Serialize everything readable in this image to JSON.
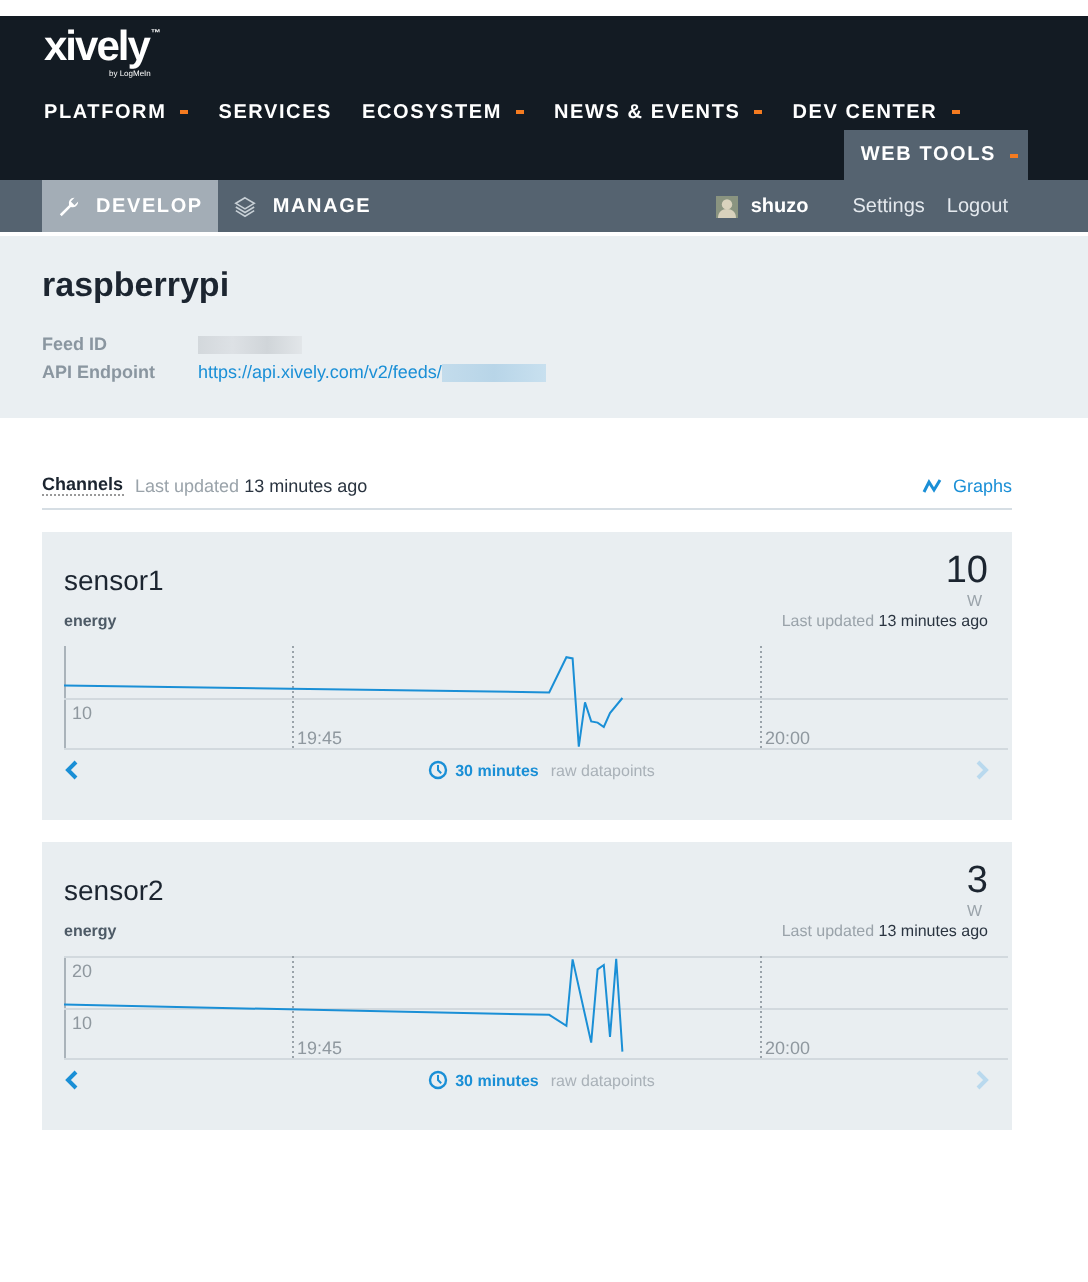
{
  "header": {
    "logo": {
      "name": "xively",
      "mark": "™",
      "tagline": "by LogMeIn"
    },
    "nav": [
      {
        "label": "PLATFORM",
        "has_menu": true
      },
      {
        "label": "SERVICES",
        "has_menu": false
      },
      {
        "label": "ECOSYSTEM",
        "has_menu": true
      },
      {
        "label": "NEWS & EVENTS",
        "has_menu": true
      },
      {
        "label": "DEV CENTER",
        "has_menu": true
      }
    ],
    "tools_tab": {
      "label": "WEB TOOLS",
      "has_menu": true,
      "selected": true
    }
  },
  "subnav": {
    "tabs": [
      {
        "label": "DEVELOP",
        "kind": "wrench",
        "selected": true
      },
      {
        "label": "MANAGE",
        "kind": "layers",
        "selected": false
      }
    ],
    "user": "shuzo",
    "links": [
      "Settings",
      "Logout"
    ]
  },
  "feed": {
    "title": "raspberrypi",
    "fields": [
      {
        "label": "Feed ID",
        "value_redacted": true
      },
      {
        "label": "API Endpoint",
        "value": "https://api.xively.com/v2/feeds/",
        "value_redacted": true
      }
    ]
  },
  "channels_bar": {
    "title": "Channels",
    "updated": "Last updated **13 minutes ago**",
    "graphs_link": "Graphs"
  },
  "channels": [
    {
      "name": "sensor1",
      "value": "10",
      "unit": "W",
      "tag": "energy",
      "updated": "Last updated **13 minutes ago**",
      "range": "30 minutes",
      "mode": "raw datapoints",
      "prev_disabled": false,
      "next_disabled": true,
      "graph": {
        "y_labels": [
          "10"
        ],
        "x_labels": [
          "19:45",
          "20:00"
        ]
      }
    },
    {
      "name": "sensor2",
      "value": "3",
      "unit": "W",
      "tag": "energy",
      "updated": "Last updated **13 minutes ago**",
      "range": "30 minutes",
      "mode": "raw datapoints",
      "prev_disabled": false,
      "next_disabled": true,
      "graph": {
        "y_labels": [
          "20",
          "10"
        ],
        "x_labels": [
          "19:45",
          "20:00"
        ]
      }
    }
  ]
}
